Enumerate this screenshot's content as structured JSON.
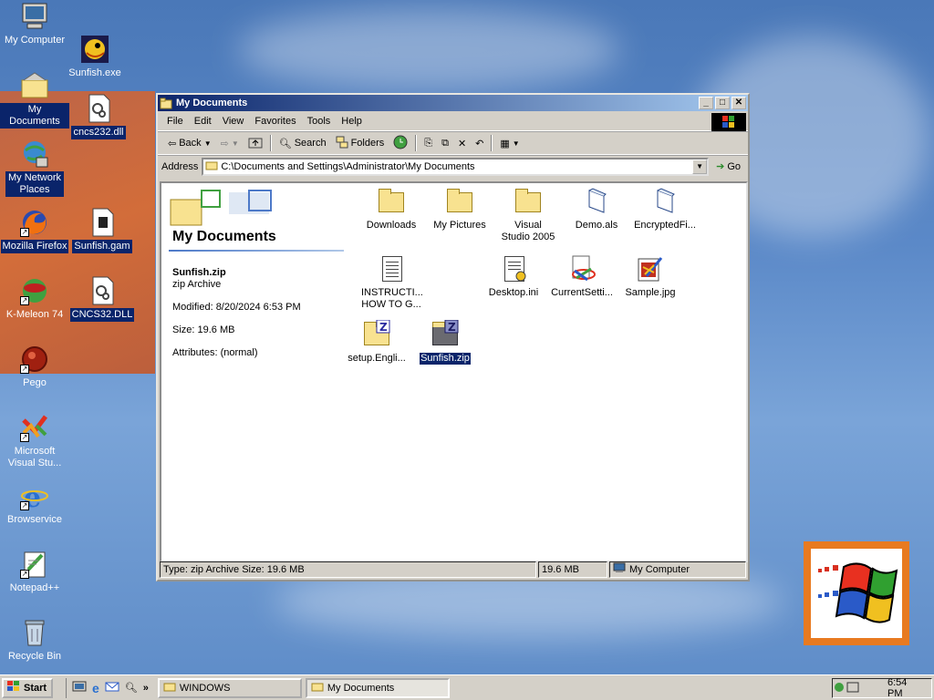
{
  "desktop": {
    "icons": [
      {
        "label": "My Computer"
      },
      {
        "label": "Sunfish.exe"
      },
      {
        "label": "My Documents"
      },
      {
        "label": "cncs232.dll"
      },
      {
        "label": "My Network Places"
      },
      {
        "label": "Mozilla Firefox"
      },
      {
        "label": "Sunfish.gam"
      },
      {
        "label": "K-Meleon 74"
      },
      {
        "label": "CNCS32.DLL"
      },
      {
        "label": "Pego"
      },
      {
        "label": "Microsoft Visual Stu..."
      },
      {
        "label": "Browservice"
      },
      {
        "label": "Notepad++"
      },
      {
        "label": "Recycle Bin"
      }
    ]
  },
  "window": {
    "title": "My Documents",
    "menu": [
      "File",
      "Edit",
      "View",
      "Favorites",
      "Tools",
      "Help"
    ],
    "toolbar": {
      "back": "Back",
      "search": "Search",
      "folders": "Folders"
    },
    "address": {
      "label": "Address",
      "value": "C:\\Documents and Settings\\Administrator\\My Documents",
      "go": "Go"
    },
    "left_pane": {
      "title": "My Documents",
      "selected_name": "Sunfish.zip",
      "selected_type": "zip Archive",
      "modified": "Modified: 8/20/2024 6:53 PM",
      "size": "Size: 19.6 MB",
      "attributes": "Attributes: (normal)"
    },
    "files": [
      {
        "label": "Downloads",
        "kind": "folder"
      },
      {
        "label": "My Pictures",
        "kind": "folder"
      },
      {
        "label": "Visual Studio 2005",
        "kind": "folder"
      },
      {
        "label": "Demo.als",
        "kind": "file"
      },
      {
        "label": "EncryptedFi...",
        "kind": "file"
      },
      {
        "label": "INSTRUCTI... HOW TO G...",
        "kind": "text"
      },
      {
        "label": "Desktop.ini",
        "kind": "ini"
      },
      {
        "label": "CurrentSetti...",
        "kind": "settings"
      },
      {
        "label": "Sample.jpg",
        "kind": "image"
      },
      {
        "label": "setup.Engli...",
        "kind": "zip"
      },
      {
        "label": "Sunfish.zip",
        "kind": "zip",
        "selected": true
      }
    ],
    "status": {
      "text": "Type: zip Archive Size: 19.6 MB",
      "size": "19.6 MB",
      "zone": "My Computer"
    }
  },
  "taskbar": {
    "start": "Start",
    "tasks": [
      {
        "label": "WINDOWS"
      },
      {
        "label": "My Documents"
      }
    ],
    "clock": "6:54 PM"
  }
}
